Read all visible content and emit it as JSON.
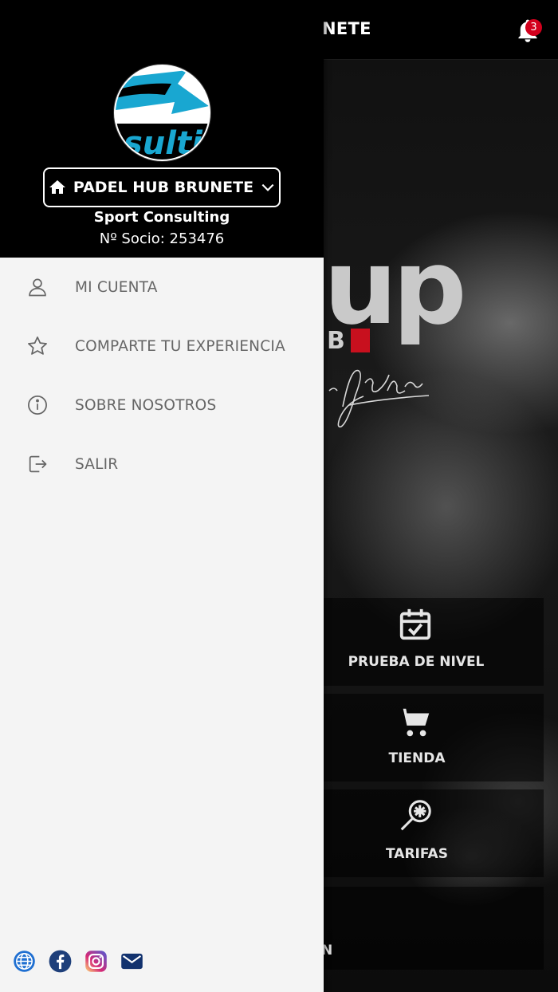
{
  "app": {
    "header_title_partial": "NETE",
    "notification_count": "3",
    "brand_partial": "up",
    "brand_sub_partial": "B",
    "bottom_partial_letter": "N"
  },
  "quick_actions": [
    {
      "label": "PRUEBA DE NIVEL",
      "icon": "calendar-check-icon"
    },
    {
      "label": "TIENDA",
      "icon": "cart-icon"
    },
    {
      "label": "TARIFAS",
      "icon": "padel-racket-icon"
    }
  ],
  "drawer": {
    "logo_text": "sulti",
    "club_name": "PADEL HUB BRUNETE",
    "user_name": "Sport Consulting",
    "member_number": "Nº Socio: 253476",
    "menu": [
      {
        "label": "MI CUENTA",
        "icon": "user-icon"
      },
      {
        "label": "COMPARTE TU EXPERIENCIA",
        "icon": "star-icon"
      },
      {
        "label": "SOBRE NOSOTROS",
        "icon": "info-icon"
      },
      {
        "label": "SALIR",
        "icon": "logout-icon"
      }
    ],
    "socials": [
      {
        "name": "website",
        "icon": "globe-icon",
        "color": "#1f6fd1"
      },
      {
        "name": "facebook",
        "icon": "facebook-icon",
        "color": "#1e3f7a"
      },
      {
        "name": "instagram",
        "icon": "instagram-icon",
        "color": "#d6249f"
      },
      {
        "name": "email",
        "icon": "mail-icon",
        "color": "#12326e"
      }
    ]
  },
  "colors": {
    "accent_blue": "#19a7d1",
    "badge_red": "#d3001d",
    "brand_red": "#c8101e",
    "drawer_bg": "#f4f4f4",
    "menu_text": "#666666"
  }
}
